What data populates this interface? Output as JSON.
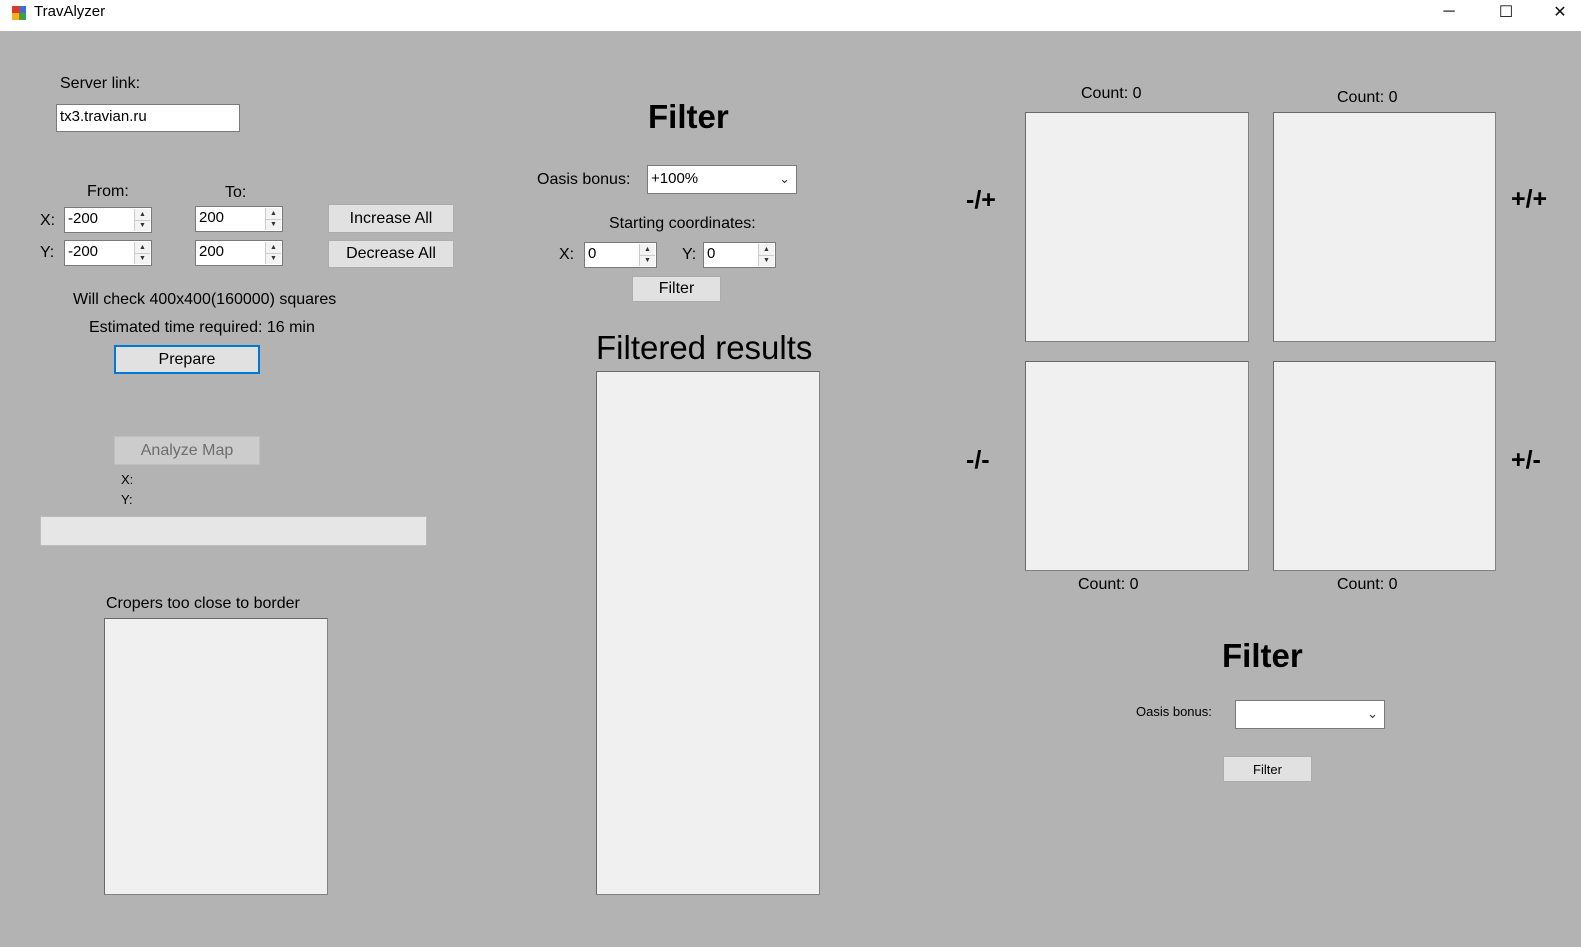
{
  "window": {
    "title": "TravAlyzer",
    "controls": {
      "minimize": "─",
      "maximize": "☐",
      "close": "✕"
    }
  },
  "server": {
    "label": "Server link:",
    "value": "tx3.travian.ru"
  },
  "range": {
    "from_label": "From:",
    "to_label": "To:",
    "x_label": "X:",
    "y_label": "Y:",
    "from_x": "-200",
    "from_y": "-200",
    "to_x": "200",
    "to_y": "200",
    "increase_all": "Increase All",
    "decrease_all": "Decrease All"
  },
  "info": {
    "will_check": "Will check 400x400(160000) squares",
    "estimated": "Estimated time required: 16 min"
  },
  "prepare_button": "Prepare",
  "analyze": {
    "button": "Analyze Map",
    "x_label": "X:",
    "y_label": "Y:"
  },
  "croppers": {
    "label": "Cropers too close to border"
  },
  "filter_center": {
    "heading": "Filter",
    "oasis_label": "Oasis bonus:",
    "oasis_value": "+100%",
    "start_label": "Starting coordinates:",
    "x_label": "X:",
    "x_value": "0",
    "y_label": "Y:",
    "y_value": "0",
    "button": "Filter",
    "results_heading": "Filtered results"
  },
  "quadrants": {
    "top_left_count": "Count: 0",
    "top_right_count": "Count: 0",
    "bottom_left_count": "Count: 0",
    "bottom_right_count": "Count: 0",
    "neg_pos": "-/+",
    "pos_pos": "+/+",
    "neg_neg": "-/-",
    "pos_neg": "+/-"
  },
  "filter_right": {
    "heading": "Filter",
    "oasis_label": "Oasis bonus:",
    "oasis_value": "",
    "button": "Filter"
  },
  "colors": {
    "background": "#b3b3b3",
    "focus": "#0078d7",
    "panel": "#f0f0f0"
  }
}
